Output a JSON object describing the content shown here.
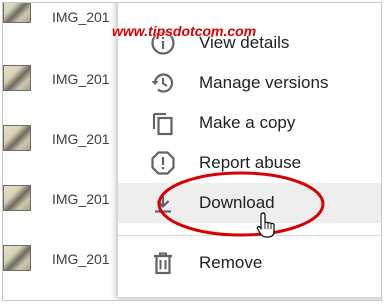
{
  "watermark": "www.tipsdotcom.com",
  "files": [
    {
      "name": "IMG_201"
    },
    {
      "name": "IMG_201"
    },
    {
      "name": "IMG_201"
    },
    {
      "name": "IMG_201"
    },
    {
      "name": "IMG_201"
    },
    {
      "name": "IMG_201"
    }
  ],
  "menu": {
    "items": [
      {
        "label": "View details",
        "icon": "info-icon"
      },
      {
        "label": "Manage versions",
        "icon": "history-icon"
      },
      {
        "label": "Make a copy",
        "icon": "copy-icon"
      },
      {
        "label": "Report abuse",
        "icon": "report-icon"
      },
      {
        "label": "Download",
        "icon": "download-icon",
        "highlighted": true
      },
      {
        "label": "Remove",
        "icon": "trash-icon"
      }
    ]
  },
  "colors": {
    "annotation": "#d90000",
    "hover": "#eeeeee",
    "icon": "#5f6368"
  }
}
